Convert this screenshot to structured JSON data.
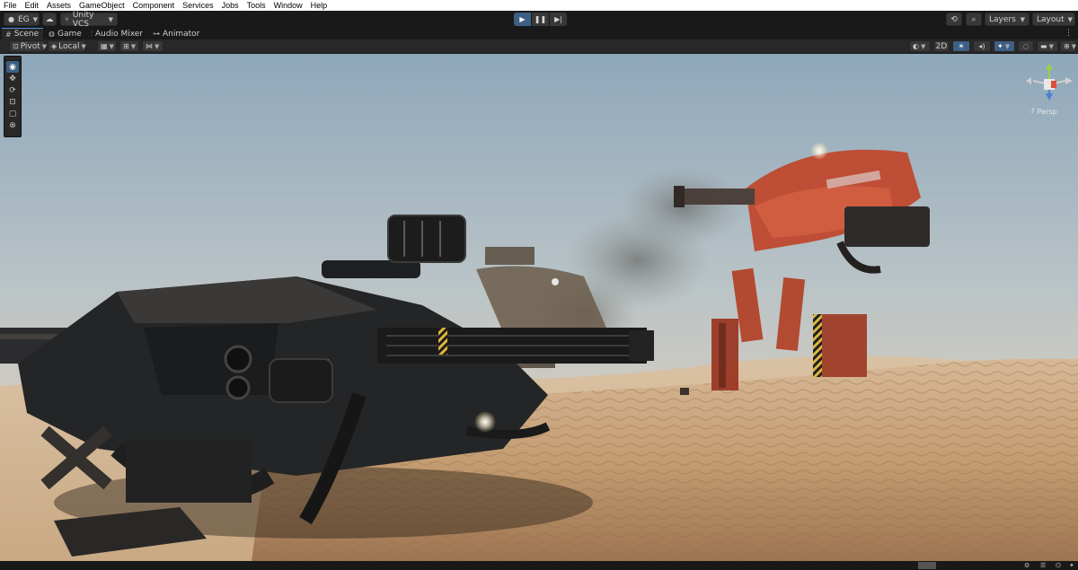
{
  "menubar": {
    "items": [
      "File",
      "Edit",
      "Assets",
      "GameObject",
      "Component",
      "Services",
      "Jobs",
      "Tools",
      "Window",
      "Help"
    ]
  },
  "toolbar": {
    "account_label": "EG",
    "vcs_label": "Unity VCS",
    "layers_label": "Layers",
    "layout_label": "Layout"
  },
  "tabs": {
    "scene": "Scene",
    "game": "Game",
    "audio_mixer": "Audio Mixer",
    "animator": "Animator"
  },
  "scene_toolbar": {
    "pivot_label": "Pivot",
    "local_label": "Local",
    "mode_2d": "2D",
    "persp_label": "Persp"
  },
  "colors": {
    "accent": "#3d5f84",
    "tab_highlight": "#4a8cd8",
    "sky_top": "#8fa8bb",
    "sand": "#c9a27a",
    "mech_red": "#b8442c"
  },
  "icons": {
    "play": "play-icon",
    "pause": "pause-icon",
    "step": "step-icon",
    "history": "history-icon",
    "search": "search-icon",
    "cloud": "cloud-icon"
  }
}
